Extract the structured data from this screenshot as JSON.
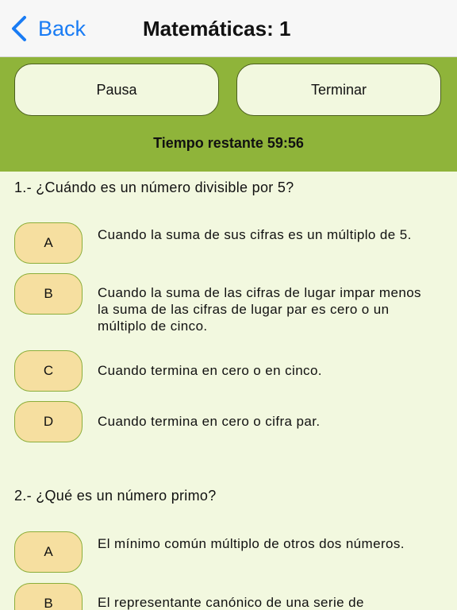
{
  "navbar": {
    "back_label": "Back",
    "title": "Matemáticas: 1"
  },
  "controls": {
    "pause_label": "Pausa",
    "finish_label": "Terminar",
    "timer_text": "Tiempo restante 59:56"
  },
  "questions": [
    {
      "text": "1.- ¿Cuándo es un número divisible por 5?",
      "answers": [
        {
          "letter": "A",
          "text": "Cuando la suma de sus cifras es un múltiplo de 5."
        },
        {
          "letter": "B",
          "text": "Cuando la suma de las cifras de lugar impar menos la suma de las cifras de lugar par es cero o un múltiplo de cinco."
        },
        {
          "letter": "C",
          "text": "Cuando termina en cero o en cinco."
        },
        {
          "letter": "D",
          "text": "Cuando termina en cero o cifra par."
        }
      ]
    },
    {
      "text": "2.- ¿Qué es un número primo?",
      "answers": [
        {
          "letter": "A",
          "text": "El mínimo común múltiplo de otros dos números."
        },
        {
          "letter": "B",
          "text": "El representante canónico de una serie de"
        }
      ]
    }
  ],
  "icons": {
    "back": "chevron-left-icon"
  },
  "colors": {
    "accent_blue": "#1a7cf4",
    "control_bar_green": "#8fb43a",
    "background": "#f2f8df",
    "answer_button": "#f6dfa0"
  }
}
